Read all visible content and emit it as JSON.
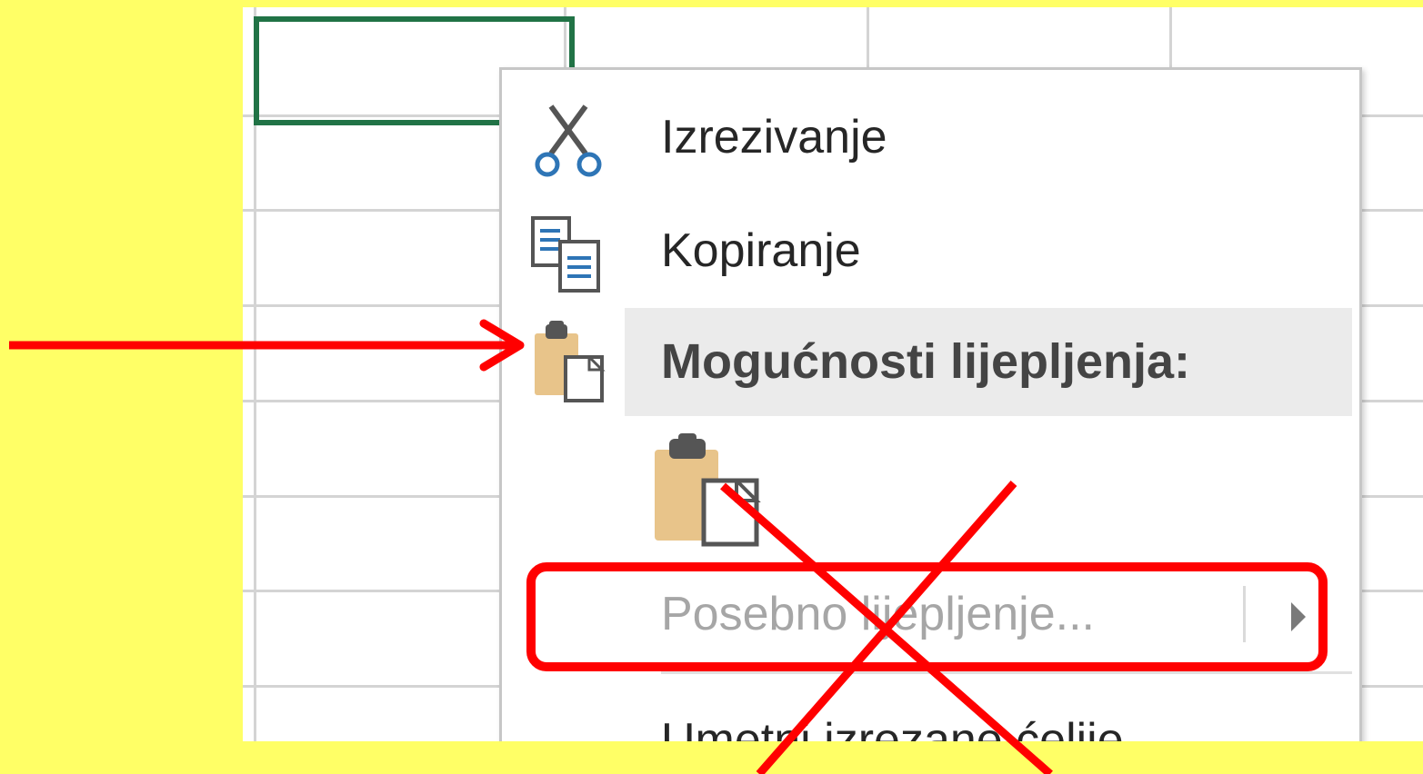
{
  "context_menu": {
    "cut_label": "Izrezivanje",
    "copy_label": "Kopiranje",
    "paste_options_header": "Mogućnosti lijepljenja:",
    "paste_special_label": "Posebno lijepljenje...",
    "insert_cut_cells_label": "Umetni izrezane ćelije"
  },
  "colors": {
    "background": "#ffff66",
    "active_cell_border": "#217346",
    "annotation": "#ff0000",
    "clipboard": "#e8c48a"
  },
  "icons": [
    "scissors-icon",
    "copy-icon",
    "clipboard-icon",
    "paste-icon",
    "chevron-right-icon"
  ]
}
